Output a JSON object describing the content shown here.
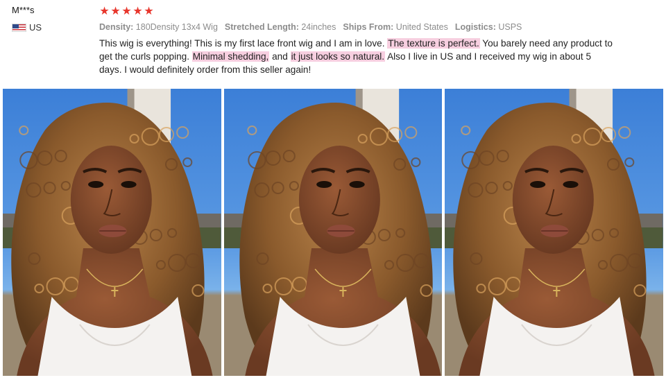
{
  "reviewer": {
    "name": "M***s",
    "country": "US"
  },
  "rating": {
    "stars": 5,
    "max": 5,
    "star_color": "#e8372d"
  },
  "specs": [
    {
      "key": "Density:",
      "value": "180Density 13x4 Wig"
    },
    {
      "key": "Stretched Length:",
      "value": "24inches"
    },
    {
      "key": "Ships From:",
      "value": "United States"
    },
    {
      "key": "Logistics:",
      "value": "USPS"
    }
  ],
  "review": {
    "segments": [
      {
        "text": "This wig is everything! This is my first lace front wig and I am in love. ",
        "highlight": false
      },
      {
        "text": "The texture is perfect.",
        "highlight": true
      },
      {
        "text": " You barely need any product to get the curls popping. ",
        "highlight": false
      },
      {
        "text": "Minimal shedding,",
        "highlight": true
      },
      {
        "text": " and ",
        "highlight": false
      },
      {
        "text": "it just looks so natural.",
        "highlight": true
      },
      {
        "text": " Also I live in US and I received my wig in about 5 days. I would definitely order from this seller again!",
        "highlight": false
      }
    ],
    "highlight_color": "#f7cfe0"
  },
  "photos": [
    {
      "icon": "customer-photo-1"
    },
    {
      "icon": "customer-photo-2"
    },
    {
      "icon": "customer-photo-3"
    }
  ]
}
